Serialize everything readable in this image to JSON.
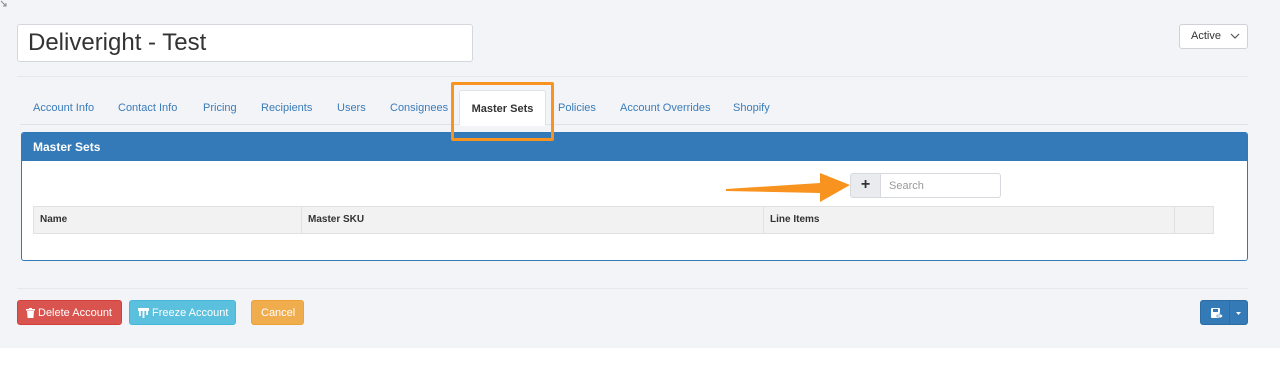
{
  "account": {
    "name": "Deliveright - Test"
  },
  "status": {
    "selected": "Active"
  },
  "tabs": [
    {
      "label": "Account Info"
    },
    {
      "label": "Contact Info"
    },
    {
      "label": "Pricing"
    },
    {
      "label": "Recipients"
    },
    {
      "label": "Users"
    },
    {
      "label": "Consignees"
    },
    {
      "label": "Master Sets",
      "active": true
    },
    {
      "label": "Policies"
    },
    {
      "label": "Account Overrides"
    },
    {
      "label": "Shopify"
    }
  ],
  "panel": {
    "title": "Master Sets",
    "add_label": "+",
    "search_placeholder": "Search",
    "columns": [
      "Name",
      "Master SKU",
      "Line Items",
      ""
    ]
  },
  "actions": {
    "delete": "Delete Account",
    "freeze": "Freeze Account",
    "cancel": "Cancel"
  },
  "colors": {
    "primary": "#337ab7",
    "danger": "#d9534f",
    "info": "#5bc0de",
    "warning": "#f0ad4e",
    "annotation": "#f7931e"
  },
  "icons": {
    "delete": "trash-icon",
    "freeze": "freeze-icon",
    "save": "save-icon",
    "dropdown": "chevron-down-icon"
  }
}
